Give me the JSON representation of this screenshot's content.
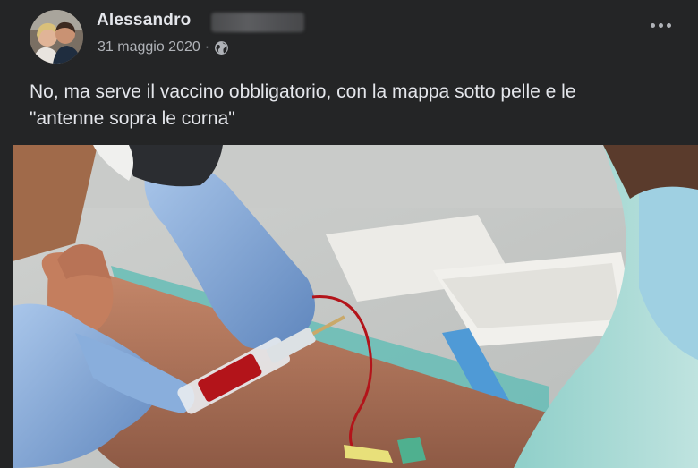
{
  "post": {
    "author": "Alessandro",
    "date": "31 maggio 2020",
    "separator": "·",
    "privacy_icon": "globe-icon",
    "more_icon": "more-options-icon",
    "text_line1": "No, ma serve il vaccino obbligatorio, con la mappa sotto pelle e le",
    "text_line2": "\"antenne sopra le corna\""
  },
  "photo": {
    "subject": "blood-draw-photo"
  },
  "colors": {
    "background": "#242526",
    "text_primary": "#e4e6eb",
    "text_secondary": "#b0b3b8",
    "glove_blue": "#7fa7d8",
    "blood_red": "#b3141a"
  }
}
